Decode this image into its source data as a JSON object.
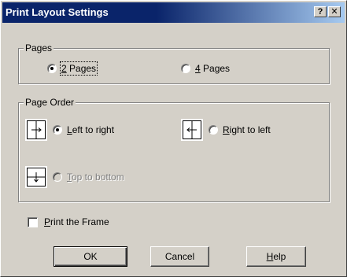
{
  "window": {
    "title": "Print Layout Settings",
    "help_glyph": "?",
    "close_glyph": "✕"
  },
  "pages_group": {
    "legend": "Pages",
    "options": [
      {
        "label": "2 Pages",
        "mnemonic": "2",
        "rest": " Pages",
        "selected": true
      },
      {
        "label": "4 Pages",
        "mnemonic": "4",
        "rest": " Pages",
        "selected": false
      }
    ]
  },
  "order_group": {
    "legend": "Page Order",
    "options": [
      {
        "label": "Left to right",
        "mnemonic": "L",
        "rest": "eft to right",
        "selected": true,
        "enabled": true,
        "icon": "left-to-right-arrow-icon"
      },
      {
        "label": "Right to left",
        "mnemonic": "R",
        "rest": "ight to left",
        "selected": false,
        "enabled": true,
        "icon": "right-to-left-arrow-icon"
      },
      {
        "label": "Top to bottom",
        "mnemonic": "T",
        "rest": "op to bottom",
        "selected": false,
        "enabled": false,
        "icon": "top-to-bottom-arrow-icon"
      }
    ]
  },
  "print_frame": {
    "label": "Print the Frame",
    "mnemonic": "P",
    "rest": "rint the Frame",
    "checked": false
  },
  "buttons": {
    "ok": "OK",
    "cancel": "Cancel",
    "help_mnemonic": "H",
    "help_rest": "elp"
  },
  "colors": {
    "face": "#d4d0c8",
    "title_start": "#0a246a",
    "title_end": "#a6caf0"
  }
}
